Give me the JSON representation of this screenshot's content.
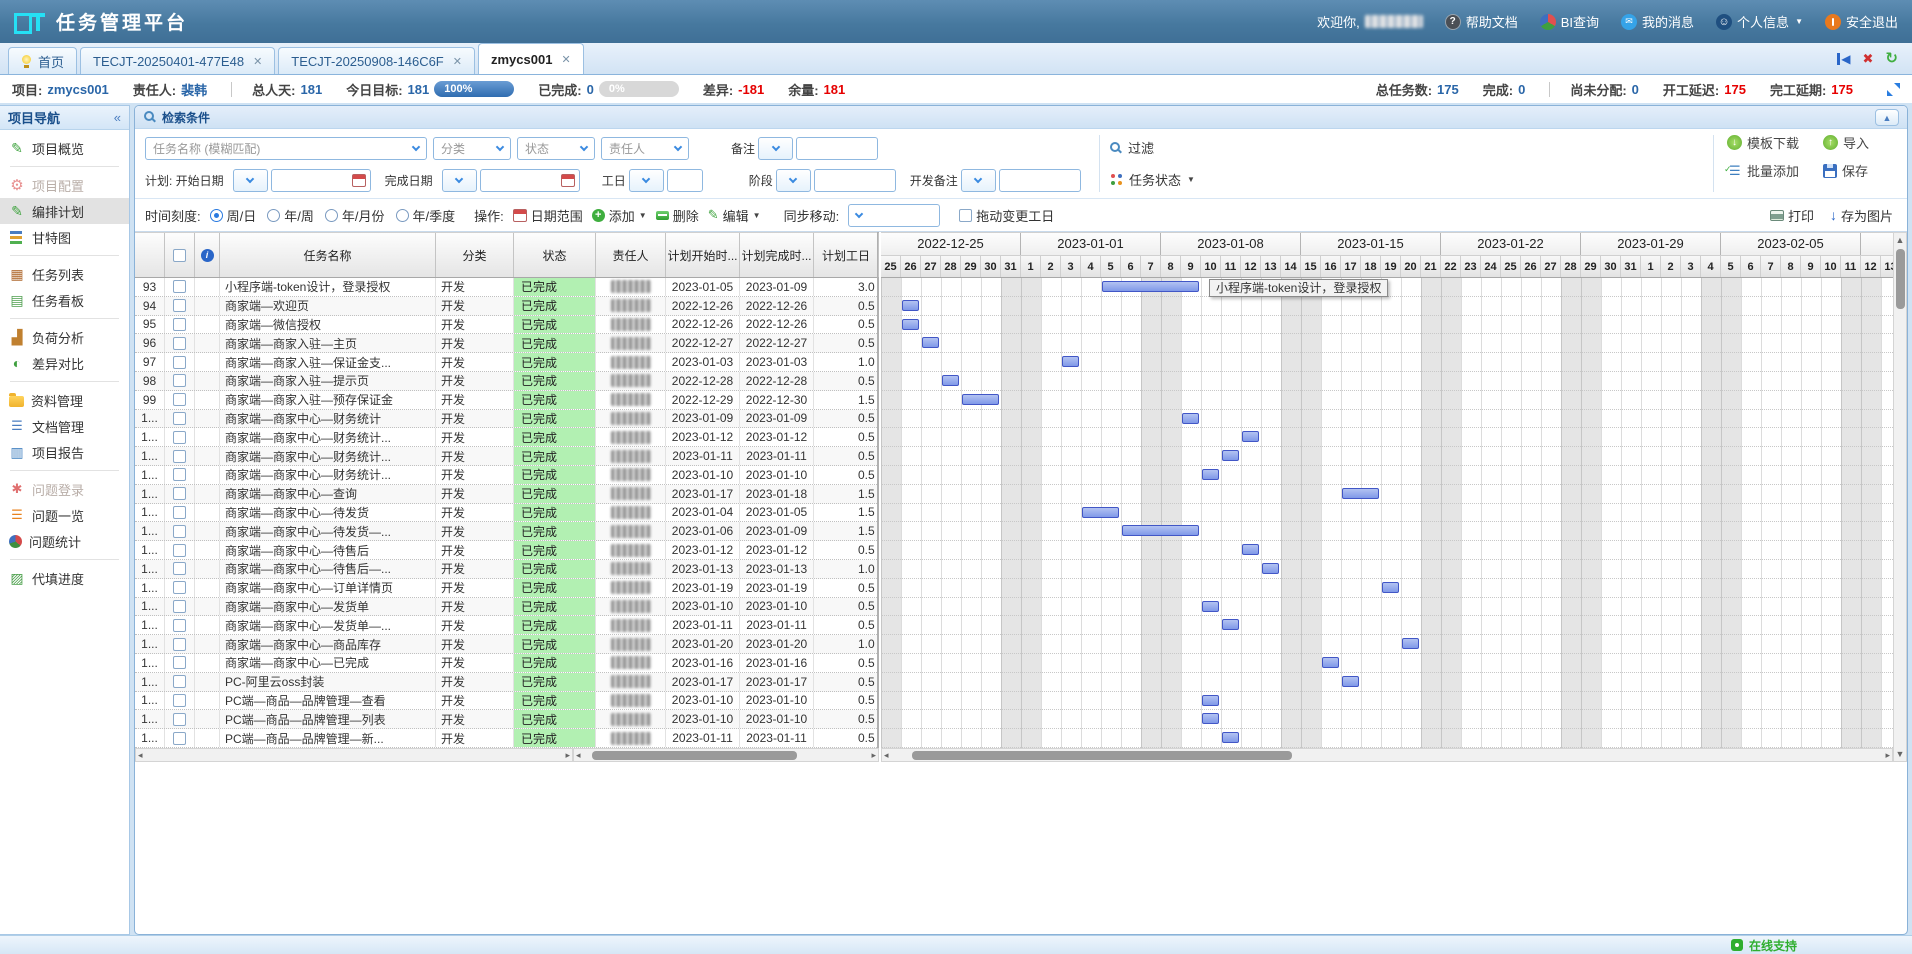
{
  "app": {
    "title": "任务管理平台",
    "welcome": "欢迎你,"
  },
  "topbar": {
    "menu": [
      {
        "id": "help-docs",
        "label": "帮助文档",
        "icon": "help"
      },
      {
        "id": "bi-query",
        "label": "BI查询",
        "icon": "bi"
      },
      {
        "id": "my-messages",
        "label": "我的消息",
        "icon": "msg"
      },
      {
        "id": "profile",
        "label": "个人信息",
        "icon": "user",
        "caret": true
      },
      {
        "id": "logout",
        "label": "安全退出",
        "icon": "power"
      }
    ]
  },
  "tabs": [
    {
      "label": "首页",
      "icon": "bulb",
      "closable": false,
      "active": false
    },
    {
      "label": "TECJT-20250401-477E48",
      "closable": true,
      "active": false
    },
    {
      "label": "TECJT-20250908-146C6F",
      "closable": true,
      "active": false
    },
    {
      "label": "zmycs001",
      "closable": true,
      "active": true
    }
  ],
  "tab_tools": [
    {
      "id": "collapse-left",
      "name": "collapse-left-icon"
    },
    {
      "id": "close-all",
      "name": "close-icon"
    },
    {
      "id": "refresh",
      "name": "refresh-icon"
    }
  ],
  "infobar": {
    "left": [
      {
        "label": "项目:",
        "value": "zmycs001",
        "color": "blue"
      },
      {
        "label": "责任人:",
        "value": "裴韩",
        "color": "blue"
      },
      {
        "sep": true
      },
      {
        "label": "总人天:",
        "value": "181",
        "color": "blue"
      },
      {
        "label": "今日目标:",
        "value": "181",
        "color": "blue",
        "pill": "100%",
        "pill_style": "blue"
      },
      {
        "label": "已完成:",
        "value": "0",
        "color": "blue",
        "pill": "0%",
        "pill_style": "gray"
      },
      {
        "label": "差异:",
        "value": "-181",
        "color": "red"
      },
      {
        "label": "余量:",
        "value": "181",
        "color": "red"
      }
    ],
    "right": [
      {
        "label": "总任务数:",
        "value": "175",
        "color": "blue"
      },
      {
        "label": "完成:",
        "value": "0",
        "color": "blue"
      },
      {
        "sep": true
      },
      {
        "label": "尚未分配:",
        "value": "0",
        "color": "blue"
      },
      {
        "label": "开工延迟:",
        "value": "175",
        "color": "red"
      },
      {
        "label": "完工延期:",
        "value": "175",
        "color": "red"
      }
    ]
  },
  "sidebar": {
    "title": "项目导航",
    "collapse_icon": "«",
    "groups": [
      [
        {
          "label": "项目概览",
          "icon": "pencil"
        }
      ],
      [
        {
          "label": "项目配置",
          "icon": "gear",
          "disabled": true
        },
        {
          "label": "编排计划",
          "icon": "pencil",
          "active": true
        },
        {
          "label": "甘特图",
          "icon": "gantt"
        }
      ],
      [
        {
          "label": "任务列表",
          "icon": "tasklist"
        },
        {
          "label": "任务看板",
          "icon": "board"
        }
      ],
      [
        {
          "label": "负荷分析",
          "icon": "load"
        },
        {
          "label": "差异对比",
          "icon": "halfpie"
        }
      ],
      [
        {
          "label": "资料管理",
          "icon": "folder"
        },
        {
          "label": "文档管理",
          "icon": "doctree"
        },
        {
          "label": "项目报告",
          "icon": "report"
        }
      ],
      [
        {
          "label": "问题登录",
          "icon": "bug",
          "disabled": true
        },
        {
          "label": "问题一览",
          "icon": "listorange"
        },
        {
          "label": "问题统计",
          "icon": "pie"
        }
      ],
      [
        {
          "label": "代填进度",
          "icon": "progress"
        }
      ]
    ]
  },
  "search": {
    "title": "检索条件",
    "row1": [
      {
        "name": "task-name",
        "kind": "select",
        "placeholder": "任务名称 (模糊匹配)"
      },
      {
        "name": "category",
        "kind": "select",
        "placeholder": "分类"
      },
      {
        "name": "status",
        "kind": "select",
        "placeholder": "状态"
      },
      {
        "name": "owner",
        "kind": "select",
        "placeholder": "责任人"
      },
      {
        "name": "remark",
        "kind": "combo",
        "label": "备注"
      }
    ],
    "row2": [
      {
        "name": "plan-start",
        "kind": "date",
        "label": "计划: 开始日期"
      },
      {
        "name": "plan-end",
        "kind": "date",
        "label": "完成日期"
      },
      {
        "name": "workday",
        "kind": "combo-small",
        "label": "工日"
      },
      {
        "name": "stage",
        "kind": "combo",
        "label": "阶段"
      },
      {
        "name": "dev-remark",
        "kind": "combo",
        "label": "开发备注"
      }
    ],
    "filter_label": "过滤",
    "task_status_label": "任务状态",
    "actions": [
      {
        "id": "template-download",
        "label": "模板下载",
        "icon": "idl"
      },
      {
        "id": "import",
        "label": "导入",
        "icon": "iul"
      },
      {
        "id": "batch-add",
        "label": "批量添加",
        "icon": "ibatch"
      },
      {
        "id": "save",
        "label": "保存",
        "icon": "ifloppy"
      }
    ]
  },
  "toolbar": {
    "time_scale_label": "时间刻度:",
    "scales": [
      {
        "label": "周/日",
        "selected": true
      },
      {
        "label": "年/周",
        "selected": false
      },
      {
        "label": "年/月份",
        "selected": false
      },
      {
        "label": "年/季度",
        "selected": false
      }
    ],
    "op_label": "操作:",
    "buttons": [
      {
        "id": "date-range",
        "label": "日期范围",
        "icon": "ical"
      },
      {
        "id": "add",
        "label": "添加",
        "icon": "iplus",
        "caret": true
      },
      {
        "id": "delete",
        "label": "删除",
        "icon": "iminus"
      },
      {
        "id": "edit",
        "label": "编辑",
        "icon": "ipencil",
        "caret": true
      }
    ],
    "sync_label": "同步移动:",
    "drag_label": "拖动变更工日",
    "right": [
      {
        "id": "print",
        "label": "打印",
        "icon": "iprint"
      },
      {
        "id": "save-image",
        "label": "存为图片",
        "icon": "idarr"
      }
    ]
  },
  "grid": {
    "columns": [
      {
        "key": "rownum",
        "label": ""
      },
      {
        "key": "select",
        "label": ""
      },
      {
        "key": "info",
        "label": ""
      },
      {
        "key": "name",
        "label": "任务名称"
      },
      {
        "key": "category",
        "label": "分类"
      },
      {
        "key": "status",
        "label": "状态"
      },
      {
        "key": "owner",
        "label": "责任人"
      },
      {
        "key": "plan_start",
        "label": "计划开始时..."
      },
      {
        "key": "plan_end",
        "label": "计划完成时..."
      },
      {
        "key": "plan_days",
        "label": "计划工日"
      }
    ],
    "rows": [
      {
        "no": "93",
        "name": "小程序端-token设计，登录授权",
        "category": "开发",
        "status": "已完成",
        "start": "2023-01-05",
        "end": "2023-01-09",
        "days": "3.0"
      },
      {
        "no": "94",
        "name": "商家端—欢迎页",
        "category": "开发",
        "status": "已完成",
        "start": "2022-12-26",
        "end": "2022-12-26",
        "days": "0.5"
      },
      {
        "no": "95",
        "name": "商家端—微信授权",
        "category": "开发",
        "status": "已完成",
        "start": "2022-12-26",
        "end": "2022-12-26",
        "days": "0.5"
      },
      {
        "no": "96",
        "name": "商家端—商家入驻—主页",
        "category": "开发",
        "status": "已完成",
        "start": "2022-12-27",
        "end": "2022-12-27",
        "days": "0.5"
      },
      {
        "no": "97",
        "name": "商家端—商家入驻—保证金支...",
        "category": "开发",
        "status": "已完成",
        "start": "2023-01-03",
        "end": "2023-01-03",
        "days": "1.0"
      },
      {
        "no": "98",
        "name": "商家端—商家入驻—提示页",
        "category": "开发",
        "status": "已完成",
        "start": "2022-12-28",
        "end": "2022-12-28",
        "days": "0.5"
      },
      {
        "no": "99",
        "name": "商家端—商家入驻—预存保证金",
        "category": "开发",
        "status": "已完成",
        "start": "2022-12-29",
        "end": "2022-12-30",
        "days": "1.5"
      },
      {
        "no": "1...",
        "name": "商家端—商家中心—财务统计",
        "category": "开发",
        "status": "已完成",
        "start": "2023-01-09",
        "end": "2023-01-09",
        "days": "0.5"
      },
      {
        "no": "1...",
        "name": "商家端—商家中心—财务统计...",
        "category": "开发",
        "status": "已完成",
        "start": "2023-01-12",
        "end": "2023-01-12",
        "days": "0.5"
      },
      {
        "no": "1...",
        "name": "商家端—商家中心—财务统计...",
        "category": "开发",
        "status": "已完成",
        "start": "2023-01-11",
        "end": "2023-01-11",
        "days": "0.5"
      },
      {
        "no": "1...",
        "name": "商家端—商家中心—财务统计...",
        "category": "开发",
        "status": "已完成",
        "start": "2023-01-10",
        "end": "2023-01-10",
        "days": "0.5"
      },
      {
        "no": "1...",
        "name": "商家端—商家中心—查询",
        "category": "开发",
        "status": "已完成",
        "start": "2023-01-17",
        "end": "2023-01-18",
        "days": "1.5"
      },
      {
        "no": "1...",
        "name": "商家端—商家中心—待发货",
        "category": "开发",
        "status": "已完成",
        "start": "2023-01-04",
        "end": "2023-01-05",
        "days": "1.5"
      },
      {
        "no": "1...",
        "name": "商家端—商家中心—待发货—...",
        "category": "开发",
        "status": "已完成",
        "start": "2023-01-06",
        "end": "2023-01-09",
        "days": "1.5"
      },
      {
        "no": "1...",
        "name": "商家端—商家中心—待售后",
        "category": "开发",
        "status": "已完成",
        "start": "2023-01-12",
        "end": "2023-01-12",
        "days": "0.5"
      },
      {
        "no": "1...",
        "name": "商家端—商家中心—待售后—...",
        "category": "开发",
        "status": "已完成",
        "start": "2023-01-13",
        "end": "2023-01-13",
        "days": "1.0"
      },
      {
        "no": "1...",
        "name": "商家端—商家中心—订单详情页",
        "category": "开发",
        "status": "已完成",
        "start": "2023-01-19",
        "end": "2023-01-19",
        "days": "0.5"
      },
      {
        "no": "1...",
        "name": "商家端—商家中心—发货单",
        "category": "开发",
        "status": "已完成",
        "start": "2023-01-10",
        "end": "2023-01-10",
        "days": "0.5"
      },
      {
        "no": "1...",
        "name": "商家端—商家中心—发货单—...",
        "category": "开发",
        "status": "已完成",
        "start": "2023-01-11",
        "end": "2023-01-11",
        "days": "0.5"
      },
      {
        "no": "1...",
        "name": "商家端—商家中心—商品库存",
        "category": "开发",
        "status": "已完成",
        "start": "2023-01-20",
        "end": "2023-01-20",
        "days": "1.0"
      },
      {
        "no": "1...",
        "name": "商家端—商家中心—已完成",
        "category": "开发",
        "status": "已完成",
        "start": "2023-01-16",
        "end": "2023-01-16",
        "days": "0.5"
      },
      {
        "no": "1...",
        "name": "PC-阿里云oss封装",
        "category": "开发",
        "status": "已完成",
        "start": "2023-01-17",
        "end": "2023-01-17",
        "days": "0.5"
      },
      {
        "no": "1...",
        "name": "PC端—商品—品牌管理—查看",
        "category": "开发",
        "status": "已完成",
        "start": "2023-01-10",
        "end": "2023-01-10",
        "days": "0.5"
      },
      {
        "no": "1...",
        "name": "PC端—商品—品牌管理—列表",
        "category": "开发",
        "status": "已完成",
        "start": "2023-01-10",
        "end": "2023-01-10",
        "days": "0.5"
      },
      {
        "no": "1...",
        "name": "PC端—商品—品牌管理—新...",
        "category": "开发",
        "status": "已完成",
        "start": "2023-01-11",
        "end": "2023-01-11",
        "days": "0.5"
      }
    ]
  },
  "gantt": {
    "start_date": "2022-12-25",
    "weeks": [
      "2022-12-25",
      "2023-01-01",
      "2023-01-08",
      "2023-01-15",
      "2023-01-22",
      "2023-01-29",
      "2023-02-05",
      ""
    ],
    "tooltip": {
      "row": 0,
      "text": "小程序端-token设计，登录授权"
    }
  },
  "statusbar": {
    "online_support": "在线支持"
  }
}
